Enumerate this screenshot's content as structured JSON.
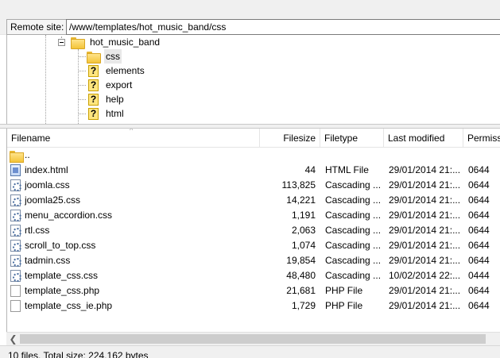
{
  "remote_site": {
    "label": "Remote site:",
    "path": "/www/templates/hot_music_band/css"
  },
  "tree": {
    "parent": "hot_music_band",
    "children": [
      "css",
      "elements",
      "export",
      "help",
      "html"
    ],
    "selected": "css"
  },
  "file_list": {
    "columns": [
      "Filename",
      "Filesize",
      "Filetype",
      "Last modified",
      "Permiss"
    ],
    "rows": [
      {
        "name": "..",
        "size": "",
        "type": "",
        "modified": "",
        "perm": "",
        "icon": "folder-icon"
      },
      {
        "name": "index.html",
        "size": "44",
        "type": "HTML File",
        "modified": "29/01/2014 21:...",
        "perm": "0644",
        "icon": "html-file-icon"
      },
      {
        "name": "joomla.css",
        "size": "113,825",
        "type": "Cascading ...",
        "modified": "29/01/2014 21:...",
        "perm": "0644",
        "icon": "css-file-icon"
      },
      {
        "name": "joomla25.css",
        "size": "14,221",
        "type": "Cascading ...",
        "modified": "29/01/2014 21:...",
        "perm": "0644",
        "icon": "css-file-icon"
      },
      {
        "name": "menu_accordion.css",
        "size": "1,191",
        "type": "Cascading ...",
        "modified": "29/01/2014 21:...",
        "perm": "0644",
        "icon": "css-file-icon"
      },
      {
        "name": "rtl.css",
        "size": "2,063",
        "type": "Cascading ...",
        "modified": "29/01/2014 21:...",
        "perm": "0644",
        "icon": "css-file-icon"
      },
      {
        "name": "scroll_to_top.css",
        "size": "1,074",
        "type": "Cascading ...",
        "modified": "29/01/2014 21:...",
        "perm": "0644",
        "icon": "css-file-icon"
      },
      {
        "name": "tadmin.css",
        "size": "19,854",
        "type": "Cascading ...",
        "modified": "29/01/2014 21:...",
        "perm": "0644",
        "icon": "css-file-icon"
      },
      {
        "name": "template_css.css",
        "size": "48,480",
        "type": "Cascading ...",
        "modified": "10/02/2014 22:...",
        "perm": "0444",
        "icon": "css-file-icon"
      },
      {
        "name": "template_css.php",
        "size": "21,681",
        "type": "PHP File",
        "modified": "29/01/2014 21:...",
        "perm": "0644",
        "icon": "php-file-icon"
      },
      {
        "name": "template_css_ie.php",
        "size": "1,729",
        "type": "PHP File",
        "modified": "29/01/2014 21:...",
        "perm": "0644",
        "icon": "php-file-icon"
      }
    ]
  },
  "status": {
    "text": "10 files. Total size: 224,162 bytes"
  },
  "colors": {
    "folder": "#f4c438",
    "unknown_folder": "#ffe680",
    "scroll_thumb": "#cdcdcd"
  }
}
